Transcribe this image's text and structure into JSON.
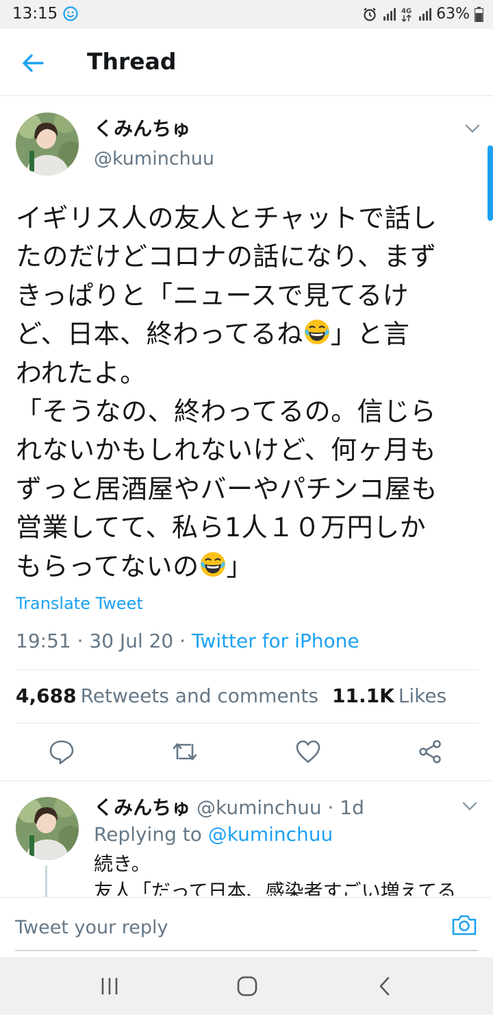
{
  "status_bar": {
    "time": "13:15",
    "battery": "63%",
    "network": "4G"
  },
  "header": {
    "title": "Thread",
    "back_icon": "arrow-left-icon"
  },
  "tweet": {
    "author_name": "くみんちゅ",
    "author_handle": "@kuminchuu",
    "text_lines": [
      "イギリス人の友人とチャットで話し",
      "たのだけどコロナの話になり、まず",
      "きっぱりと「ニュースで見てるけ",
      "ど、日本、終わってるね",
      "」と言",
      "われたよ。",
      "「そうなの、終わってるの。信じら",
      "れないかもしれないけど、何ヶ月も",
      "ずっと居酒屋やバーやパチンコ屋も",
      "営業してて、私ら1人１０万円しか",
      "もらってないの",
      "」"
    ],
    "emoji": "face-with-tears-of-joy",
    "translate_label": "Translate Tweet",
    "time": "19:51",
    "date": "30 Jul 20",
    "separator": " · ",
    "app": "Twitter for iPhone",
    "retweets_count": "4,688",
    "retweets_label": "Retweets and comments",
    "likes_count": "11.1K",
    "likes_label": "Likes"
  },
  "actions": [
    "reply-icon",
    "retweet-icon",
    "like-icon",
    "share-icon"
  ],
  "reply": {
    "author_name": "くみんちゅ",
    "author_handle": "@kuminchuu",
    "age": "1d",
    "replying_label": "Replying to",
    "replying_handle": "@kuminchuu",
    "text_line1": "続き。",
    "text_line2": "友人「だって日本、感染者すごい増えてる"
  },
  "compose": {
    "placeholder": "Tweet your reply"
  },
  "colors": {
    "accent": "#1da1f2",
    "secondary_text": "#657786",
    "divider": "#e1e8ed"
  }
}
